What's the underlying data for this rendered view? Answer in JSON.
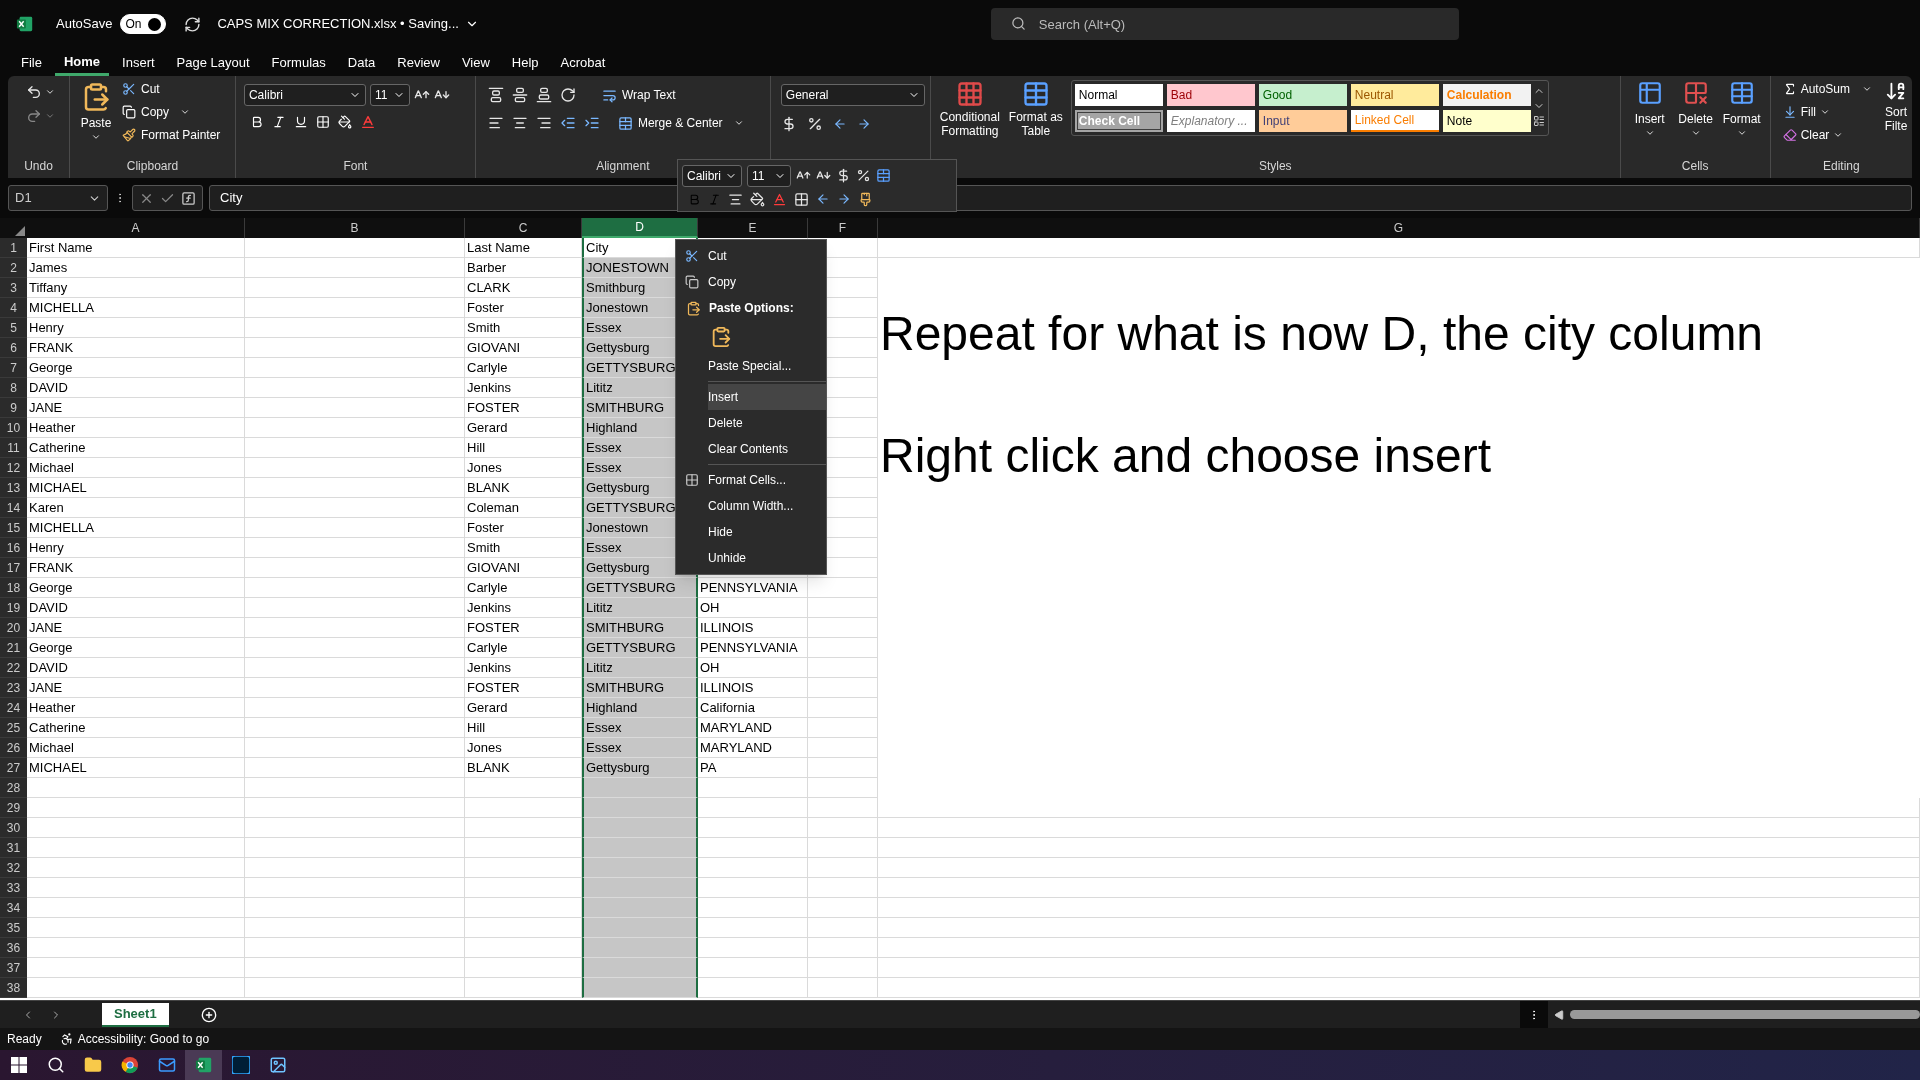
{
  "title_bar": {
    "autosave_label": "AutoSave",
    "autosave_toggle": {
      "text": "On",
      "on": true
    },
    "file_title": "CAPS MIX CORRECTION.xlsx • Saving...",
    "search": {
      "placeholder": "Search (Alt+Q)"
    }
  },
  "menu_tabs": [
    {
      "label": "File",
      "selected": false
    },
    {
      "label": "Home",
      "selected": true
    },
    {
      "label": "Insert",
      "selected": false
    },
    {
      "label": "Page Layout",
      "selected": false
    },
    {
      "label": "Formulas",
      "selected": false
    },
    {
      "label": "Data",
      "selected": false
    },
    {
      "label": "Review",
      "selected": false
    },
    {
      "label": "View",
      "selected": false
    },
    {
      "label": "Help",
      "selected": false
    },
    {
      "label": "Acrobat",
      "selected": false
    }
  ],
  "ribbon": {
    "undo": {
      "label": "Undo"
    },
    "clipboard": {
      "label": "Clipboard",
      "paste": "Paste",
      "cut": "Cut",
      "copy": "Copy",
      "format_painter": "Format Painter"
    },
    "font": {
      "label": "Font",
      "family": "Calibri",
      "size": "11"
    },
    "alignment": {
      "label": "Alignment",
      "wrap_text": "Wrap Text",
      "merge": "Merge & Center"
    },
    "number": {
      "format": "General"
    },
    "styles": {
      "label": "Styles",
      "conditional": "Conditional Formatting",
      "format_table": "Format as Table",
      "gallery": [
        {
          "label": "Normal",
          "kind": "normal",
          "color": "#ffffff"
        },
        {
          "label": "Bad",
          "kind": "bad",
          "color": "#ffc7ce"
        },
        {
          "label": "Good",
          "kind": "good",
          "color": "#c6efce"
        },
        {
          "label": "Neutral",
          "kind": "neutral",
          "color": "#ffeb9c"
        },
        {
          "label": "Calculation",
          "kind": "calculation",
          "color": "#f2f2f2"
        },
        {
          "label": "Check Cell",
          "kind": "check",
          "color": "#a5a5a5"
        },
        {
          "label": "Explanatory ...",
          "kind": "explanatory",
          "color": "#ffffff"
        },
        {
          "label": "Input",
          "kind": "input",
          "color": "#ffcc99"
        },
        {
          "label": "Linked Cell",
          "kind": "linked",
          "color": "#ffffff"
        },
        {
          "label": "Note",
          "kind": "note",
          "color": "#ffffcc"
        }
      ]
    },
    "cells": {
      "label": "Cells",
      "buttons": [
        "Insert",
        "Delete",
        "Format"
      ]
    },
    "editing": {
      "label": "Editing",
      "autosum": "AutoSum",
      "fill": "Fill",
      "clear": "Clear",
      "sort_filter": "Sort Filte"
    }
  },
  "formula_bar": {
    "name_box": "D1",
    "formula": "City"
  },
  "mini_toolbar": {
    "font": "Calibri",
    "size": "11"
  },
  "columns": [
    {
      "label": "A",
      "selected": false
    },
    {
      "label": "B",
      "selected": false
    },
    {
      "label": "C",
      "selected": false
    },
    {
      "label": "D",
      "selected": true
    },
    {
      "label": "E",
      "selected": false
    },
    {
      "label": "F",
      "selected": false
    },
    {
      "label": "G",
      "selected": false
    }
  ],
  "rows": [
    {
      "label": "1",
      "cells": [
        "First Name",
        null,
        "Last Name",
        "City"
      ]
    },
    {
      "label": "2",
      "cells": [
        "James",
        null,
        "Barber",
        "JONESTOWN"
      ]
    },
    {
      "label": "3",
      "cells": [
        "Tiffany",
        null,
        "CLARK",
        "Smithburg"
      ]
    },
    {
      "label": "4",
      "cells": [
        "MICHELLA",
        null,
        "Foster",
        "Jonestown"
      ]
    },
    {
      "label": "5",
      "cells": [
        "Henry",
        null,
        "Smith",
        "Essex"
      ]
    },
    {
      "label": "6",
      "cells": [
        "FRANK",
        null,
        "GIOVANI",
        "Gettysburg"
      ]
    },
    {
      "label": "7",
      "cells": [
        "George",
        null,
        "Carlyle",
        "GETTYSBURG"
      ]
    },
    {
      "label": "8",
      "cells": [
        "DAVID",
        null,
        "Jenkins",
        "Lititz"
      ]
    },
    {
      "label": "9",
      "cells": [
        "JANE",
        null,
        "FOSTER",
        "SMITHBURG"
      ]
    },
    {
      "label": "10",
      "cells": [
        "Heather",
        null,
        "Gerard",
        "Highland"
      ]
    },
    {
      "label": "11",
      "cells": [
        "Catherine",
        null,
        "Hill",
        "Essex"
      ]
    },
    {
      "label": "12",
      "cells": [
        "Michael",
        null,
        "Jones",
        "Essex"
      ]
    },
    {
      "label": "13",
      "cells": [
        "MICHAEL",
        null,
        "BLANK",
        "Gettysburg"
      ]
    },
    {
      "label": "14",
      "cells": [
        "Karen",
        null,
        "Coleman",
        "GETTYSBURG"
      ]
    },
    {
      "label": "15",
      "cells": [
        "MICHELLA",
        null,
        "Foster",
        "Jonestown"
      ]
    },
    {
      "label": "16",
      "cells": [
        "Henry",
        null,
        "Smith",
        "Essex"
      ]
    },
    {
      "label": "17",
      "cells": [
        "FRANK",
        null,
        "GIOVANI",
        "Gettysburg"
      ]
    },
    {
      "label": "18",
      "cells": [
        "George",
        null,
        "Carlyle",
        "GETTYSBURG",
        "PENNSYLVANIA"
      ]
    },
    {
      "label": "19",
      "cells": [
        "DAVID",
        null,
        "Jenkins",
        "Lititz",
        "OH"
      ]
    },
    {
      "label": "20",
      "cells": [
        "JANE",
        null,
        "FOSTER",
        "SMITHBURG",
        "ILLINOIS"
      ]
    },
    {
      "label": "21",
      "cells": [
        "George",
        null,
        "Carlyle",
        "GETTYSBURG",
        "PENNSYLVANIA"
      ]
    },
    {
      "label": "22",
      "cells": [
        "DAVID",
        null,
        "Jenkins",
        "Lititz",
        "OH"
      ]
    },
    {
      "label": "23",
      "cells": [
        "JANE",
        null,
        "FOSTER",
        "SMITHBURG",
        "ILLINOIS"
      ]
    },
    {
      "label": "24",
      "cells": [
        "Heather",
        null,
        "Gerard",
        "Highland",
        "California"
      ]
    },
    {
      "label": "25",
      "cells": [
        "Catherine",
        null,
        "Hill",
        "Essex",
        "MARYLAND"
      ]
    },
    {
      "label": "26",
      "cells": [
        "Michael",
        null,
        "Jones",
        "Essex",
        "MARYLAND"
      ]
    },
    {
      "label": "27",
      "cells": [
        "MICHAEL",
        null,
        "BLANK",
        "Gettysburg",
        "PA"
      ]
    },
    {
      "label": "28"
    },
    {
      "label": "29"
    },
    {
      "label": "30"
    },
    {
      "label": "31"
    },
    {
      "label": "32"
    },
    {
      "label": "33"
    },
    {
      "label": "34"
    },
    {
      "label": "35"
    },
    {
      "label": "36"
    },
    {
      "label": "37"
    },
    {
      "label": "38"
    }
  ],
  "text_box": [
    "Repeat for what is now D, the city column",
    "Right click and choose insert"
  ],
  "context_menu": [
    {
      "kind": "cut",
      "label": "Cut",
      "selected": false
    },
    {
      "kind": "copy",
      "label": "Copy",
      "selected": false
    },
    {
      "kind": "heading",
      "label": "Paste Options:"
    },
    {
      "kind": "paste_icons"
    },
    {
      "kind": "item",
      "label": "Paste Special...",
      "selected": false
    },
    {
      "kind": "separator"
    },
    {
      "kind": "item",
      "label": "Insert",
      "selected": true
    },
    {
      "kind": "item",
      "label": "Delete",
      "selected": false
    },
    {
      "kind": "item",
      "label": "Clear Contents",
      "selected": false
    },
    {
      "kind": "separator"
    },
    {
      "kind": "format",
      "label": "Format Cells...",
      "selected": false
    },
    {
      "kind": "item",
      "label": "Column Width...",
      "selected": false
    },
    {
      "kind": "item",
      "label": "Hide",
      "selected": false
    },
    {
      "kind": "item",
      "label": "Unhide",
      "selected": false
    }
  ],
  "sheet_tabs": [
    {
      "label": "Sheet1",
      "selected": true
    }
  ],
  "status_bar": {
    "ready": "Ready",
    "accessibility": "Accessibility: Good to go"
  },
  "taskbar": [
    {
      "kind": "start",
      "active": false
    },
    {
      "kind": "search",
      "active": false
    },
    {
      "kind": "files",
      "active": false
    },
    {
      "kind": "browser",
      "active": false
    },
    {
      "kind": "mail",
      "active": false
    },
    {
      "kind": "sheets",
      "active": true
    },
    {
      "kind": "photoshop",
      "active": false
    },
    {
      "kind": "photos",
      "active": false
    }
  ]
}
